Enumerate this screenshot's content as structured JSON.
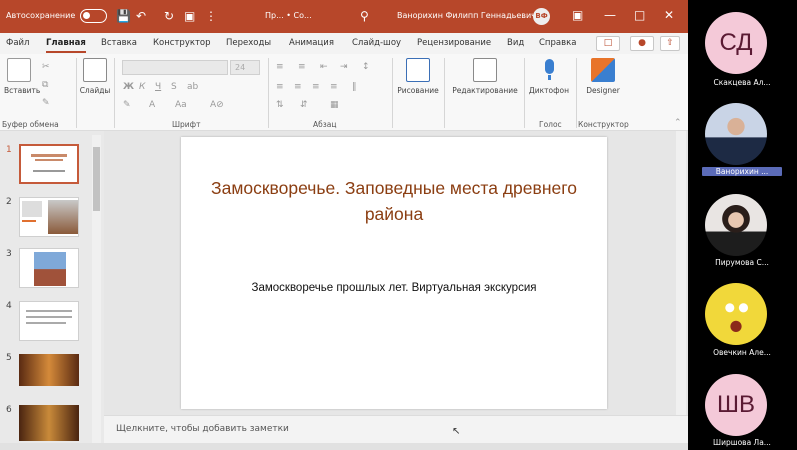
{
  "titlebar": {
    "autosave_label": "Автосохранение",
    "doc_title": "Пр... • Со...",
    "user_name": "Ванорихин Филипп Геннадьевич",
    "user_initials": "ВФ"
  },
  "tabs": [
    {
      "label": "Файл"
    },
    {
      "label": "Главная"
    },
    {
      "label": "Вставка"
    },
    {
      "label": "Конструктор"
    },
    {
      "label": "Переходы"
    },
    {
      "label": "Анимация"
    },
    {
      "label": "Слайд-шоу"
    },
    {
      "label": "Рецензирование"
    },
    {
      "label": "Вид"
    },
    {
      "label": "Справка"
    }
  ],
  "ribbon": {
    "paste_label": "Вставить",
    "clipboard_group": "Буфер обмена",
    "slides_label": "Слайды",
    "font_size": "24",
    "font_group": "Шрифт",
    "paragraph_group": "Абзац",
    "drawing_label": "Рисование",
    "editing_label": "Редактирование",
    "dictate_label": "Диктофон",
    "voice_group": "Голос",
    "designer_label": "Designer",
    "designer_group": "Конструктор"
  },
  "thumbnails": [
    {
      "num": "1"
    },
    {
      "num": "2"
    },
    {
      "num": "3"
    },
    {
      "num": "4"
    },
    {
      "num": "5"
    },
    {
      "num": "6"
    }
  ],
  "slide": {
    "title": "Замоскворечье. Заповедные места древнего района",
    "subtitle": "Замоскворечье прошлых лет. Виртуальная экскурсия"
  },
  "notes": {
    "placeholder": "Щелкните, чтобы добавить заметки"
  },
  "participants": [
    {
      "initials": "СД",
      "name": "Скакцева Ал..."
    },
    {
      "name": "Ванорихин ..."
    },
    {
      "name": "Пирумова С..."
    },
    {
      "name": "Овечкин Але..."
    },
    {
      "initials": "ШВ",
      "name": "Ширшова Ла..."
    }
  ],
  "colors": {
    "accent": "#b7472a",
    "slide_title": "#8b3e12",
    "avatar_bg": "#f4c9d8",
    "highlight_name": "#5b6bb8"
  }
}
